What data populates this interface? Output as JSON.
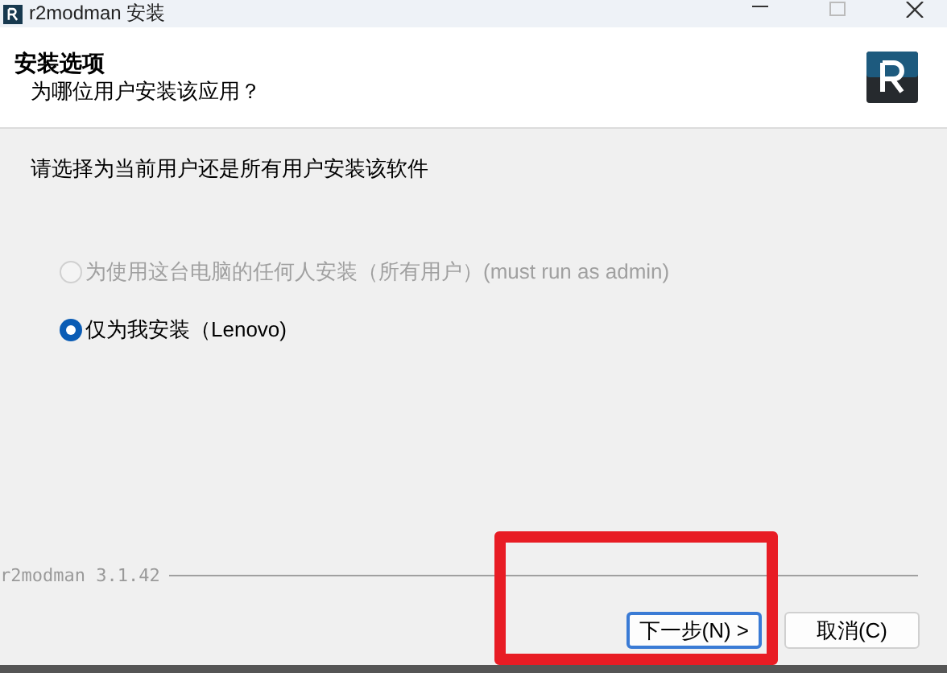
{
  "window": {
    "title": "r2modman 安装"
  },
  "header": {
    "title": "安装选项",
    "subtitle": "为哪位用户安装该应用？"
  },
  "prompt": "请选择为当前用户还是所有用户安装该软件",
  "options": [
    {
      "label": "为使用这台电脑的任何人安装（所有用户）(must run as admin)",
      "selected": false,
      "disabled": true
    },
    {
      "label": "仅为我安装（Lenovo)",
      "selected": true,
      "disabled": false
    }
  ],
  "branding": "r2modman 3.1.42",
  "buttons": [
    {
      "label": "下一步(N) >",
      "default": true
    },
    {
      "label": "取消(C)",
      "default": false
    }
  ],
  "annotations": [
    {
      "kind": "rectangle"
    }
  ]
}
